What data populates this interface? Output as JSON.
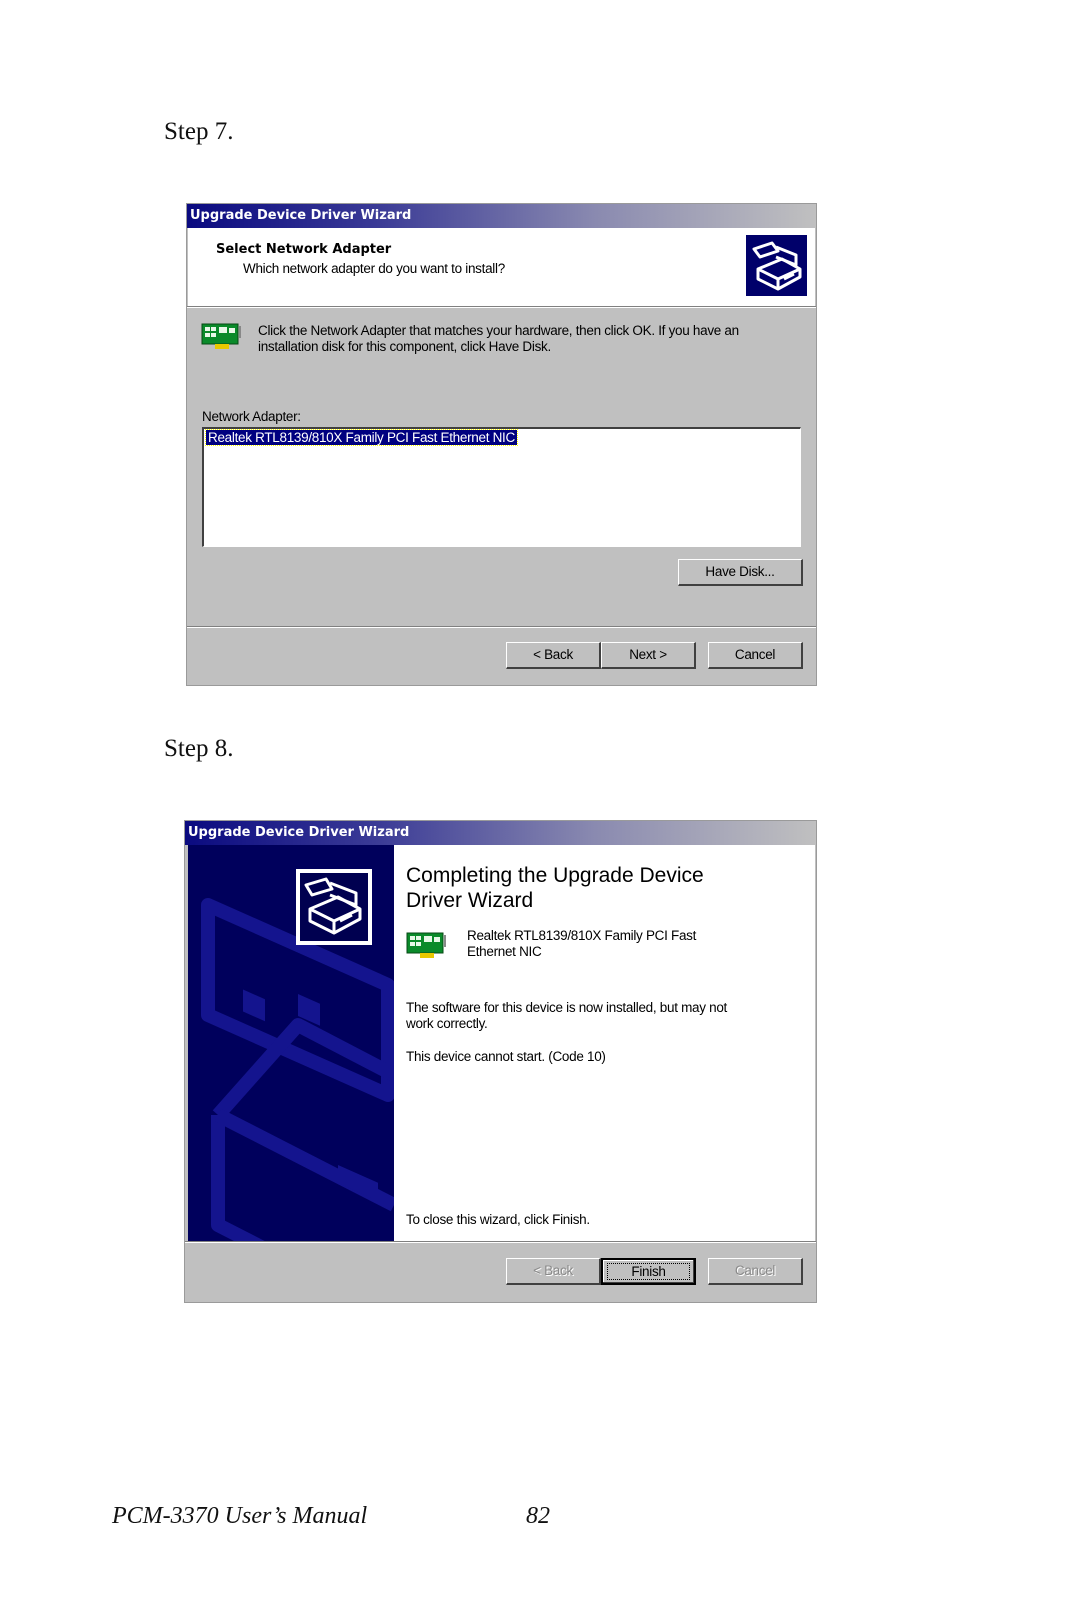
{
  "document": {
    "footer_title": "PCM-3370 User’s Manual",
    "page_number": "82"
  },
  "step7": {
    "heading": "Step 7.",
    "dialog": {
      "title": "Upgrade Device Driver Wizard",
      "header_title": "Select Network Adapter",
      "header_subtitle": "Which network adapter do you want to install?",
      "header_icon": "hardware-wizard-icon",
      "instruction_icon": "network-card-icon",
      "instruction": "Click the Network Adapter that matches your hardware, then click OK. If you have an installation disk for this component, click Have Disk.",
      "list_label": "Network Adapter:",
      "list_items": [
        "Realtek RTL8139/810X Family PCI Fast Ethernet NIC"
      ],
      "selected_item": "Realtek RTL8139/810X Family PCI Fast Ethernet NIC",
      "have_disk_label": "Have Disk...",
      "back_label": "< Back",
      "next_label": "Next >",
      "cancel_label": "Cancel"
    }
  },
  "step8": {
    "heading": "Step 8.",
    "dialog": {
      "title": "Upgrade Device Driver Wizard",
      "sidebar_icon": "hardware-wizard-icon",
      "heading": "Completing the Upgrade Device Driver Wizard",
      "device_icon": "network-card-icon",
      "device_name": "Realtek RTL8139/810X Family PCI Fast Ethernet NIC",
      "status_message": "The software for this device is now installed, but may not work correctly.",
      "error_message": "This device cannot start. (Code 10)",
      "close_hint": "To close this wizard, click Finish.",
      "back_label": "< Back",
      "finish_label": "Finish",
      "cancel_label": "Cancel",
      "back_enabled": false,
      "cancel_enabled": false
    }
  },
  "colors": {
    "titlebar_start": "#0a0a80",
    "dialog_face": "#c0c0c0",
    "selection": "#000080",
    "sidebar_bg": "#000060"
  }
}
